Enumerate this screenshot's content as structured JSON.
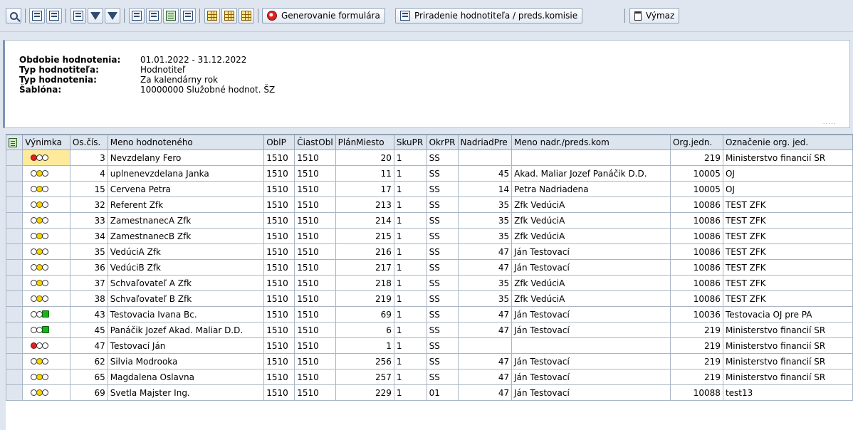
{
  "toolbar": {
    "generate_label": "Generovanie formulára",
    "assign_label": "Priradenie hodnotiteľa / preds.komisie",
    "delete_label": "Výmaz"
  },
  "info": {
    "period_label": "Obdobie hodnotenia:",
    "period_value": "01.01.2022 - 31.12.2022",
    "evaluator_type_label": "Typ hodnotiteľa:",
    "evaluator_type_value": "Hodnotiteľ",
    "evaluation_type_label": "Typ hodnotenia:",
    "evaluation_type_value": "Za kalendárny rok",
    "template_label": "Šablóna:",
    "template_value": "10000000 Služobné hodnot. ŠZ"
  },
  "table": {
    "headers": {
      "exception": "Výnimka",
      "pers_no": "Os.čís.",
      "name": "Meno hodnoteného",
      "oblp": "OblP",
      "partobl": "ČiastObl",
      "planned_pos": "PlánMiesto",
      "skupr": "SkuPR",
      "okrpr": "OkrPR",
      "superior": "NadriadPre",
      "superior_name": "Meno nadr./preds.kom",
      "org_unit": "Org.jedn.",
      "org_unit_name": "Označenie org. jed."
    },
    "rows": [
      {
        "status": "red",
        "hl": true,
        "pers_no": "3",
        "name": "Nevzdelany Fero",
        "oblp": "1510",
        "partobl": "1510",
        "planned_pos": "20",
        "skupr": "1",
        "okrpr": "SS",
        "superior": "",
        "superior_name": "",
        "org_unit": "219",
        "org_unit_name": "Ministerstvo financií SR"
      },
      {
        "status": "yellow",
        "hl": false,
        "pers_no": "4",
        "name": "uplnenevzdelana Janka",
        "oblp": "1510",
        "partobl": "1510",
        "planned_pos": "11",
        "skupr": "1",
        "okrpr": "SS",
        "superior": "45",
        "superior_name": "Akad. Maliar Jozef Panáčik D.D.",
        "org_unit": "10005",
        "org_unit_name": "OJ"
      },
      {
        "status": "yellow",
        "hl": false,
        "pers_no": "15",
        "name": "Cervena Petra",
        "oblp": "1510",
        "partobl": "1510",
        "planned_pos": "17",
        "skupr": "1",
        "okrpr": "SS",
        "superior": "14",
        "superior_name": "Petra Nadriadena",
        "org_unit": "10005",
        "org_unit_name": "OJ"
      },
      {
        "status": "yellow",
        "hl": false,
        "pers_no": "32",
        "name": "Referent Zfk",
        "oblp": "1510",
        "partobl": "1510",
        "planned_pos": "213",
        "skupr": "1",
        "okrpr": "SS",
        "superior": "35",
        "superior_name": "Zfk VedúciA",
        "org_unit": "10086",
        "org_unit_name": "TEST ZFK"
      },
      {
        "status": "yellow",
        "hl": false,
        "pers_no": "33",
        "name": "ZamestnanecA Zfk",
        "oblp": "1510",
        "partobl": "1510",
        "planned_pos": "214",
        "skupr": "1",
        "okrpr": "SS",
        "superior": "35",
        "superior_name": "Zfk VedúciA",
        "org_unit": "10086",
        "org_unit_name": "TEST ZFK"
      },
      {
        "status": "yellow",
        "hl": false,
        "pers_no": "34",
        "name": "ZamestnanecB Zfk",
        "oblp": "1510",
        "partobl": "1510",
        "planned_pos": "215",
        "skupr": "1",
        "okrpr": "SS",
        "superior": "35",
        "superior_name": "Zfk VedúciA",
        "org_unit": "10086",
        "org_unit_name": "TEST ZFK"
      },
      {
        "status": "yellow",
        "hl": false,
        "pers_no": "35",
        "name": "VedúciA Zfk",
        "oblp": "1510",
        "partobl": "1510",
        "planned_pos": "216",
        "skupr": "1",
        "okrpr": "SS",
        "superior": "47",
        "superior_name": "Ján Testovací",
        "org_unit": "10086",
        "org_unit_name": "TEST ZFK"
      },
      {
        "status": "yellow",
        "hl": false,
        "pers_no": "36",
        "name": "VedúciB Zfk",
        "oblp": "1510",
        "partobl": "1510",
        "planned_pos": "217",
        "skupr": "1",
        "okrpr": "SS",
        "superior": "47",
        "superior_name": "Ján Testovací",
        "org_unit": "10086",
        "org_unit_name": "TEST ZFK"
      },
      {
        "status": "yellow",
        "hl": false,
        "pers_no": "37",
        "name": "Schvaľovateľ A Zfk",
        "oblp": "1510",
        "partobl": "1510",
        "planned_pos": "218",
        "skupr": "1",
        "okrpr": "SS",
        "superior": "35",
        "superior_name": "Zfk VedúciA",
        "org_unit": "10086",
        "org_unit_name": "TEST ZFK"
      },
      {
        "status": "yellow",
        "hl": false,
        "pers_no": "38",
        "name": "Schvaľovateľ B Zfk",
        "oblp": "1510",
        "partobl": "1510",
        "planned_pos": "219",
        "skupr": "1",
        "okrpr": "SS",
        "superior": "35",
        "superior_name": "Zfk VedúciA",
        "org_unit": "10086",
        "org_unit_name": "TEST ZFK"
      },
      {
        "status": "green",
        "hl": false,
        "pers_no": "43",
        "name": "Testovacia Ivana Bc.",
        "oblp": "1510",
        "partobl": "1510",
        "planned_pos": "69",
        "skupr": "1",
        "okrpr": "SS",
        "superior": "47",
        "superior_name": "Ján Testovací",
        "org_unit": "10036",
        "org_unit_name": "Testovacia OJ pre PA"
      },
      {
        "status": "green",
        "hl": false,
        "pers_no": "45",
        "name": "Panáčik Jozef Akad. Maliar D.D.",
        "oblp": "1510",
        "partobl": "1510",
        "planned_pos": "6",
        "skupr": "1",
        "okrpr": "SS",
        "superior": "47",
        "superior_name": "Ján Testovací",
        "org_unit": "219",
        "org_unit_name": "Ministerstvo financií SR"
      },
      {
        "status": "red",
        "hl": false,
        "pers_no": "47",
        "name": "Testovací Ján",
        "oblp": "1510",
        "partobl": "1510",
        "planned_pos": "1",
        "skupr": "1",
        "okrpr": "SS",
        "superior": "",
        "superior_name": "",
        "org_unit": "219",
        "org_unit_name": "Ministerstvo financií SR"
      },
      {
        "status": "yellow",
        "hl": false,
        "pers_no": "62",
        "name": "Silvia Modrooka",
        "oblp": "1510",
        "partobl": "1510",
        "planned_pos": "256",
        "skupr": "1",
        "okrpr": "SS",
        "superior": "47",
        "superior_name": "Ján Testovací",
        "org_unit": "219",
        "org_unit_name": "Ministerstvo financií SR"
      },
      {
        "status": "yellow",
        "hl": false,
        "pers_no": "65",
        "name": "Magdalena Oslavna",
        "oblp": "1510",
        "partobl": "1510",
        "planned_pos": "257",
        "skupr": "1",
        "okrpr": "SS",
        "superior": "47",
        "superior_name": "Ján Testovací",
        "org_unit": "219",
        "org_unit_name": "Ministerstvo financií SR"
      },
      {
        "status": "yellow",
        "hl": false,
        "pers_no": "69",
        "name": "Svetla Majster Ing.",
        "oblp": "1510",
        "partobl": "1510",
        "planned_pos": "229",
        "skupr": "1",
        "okrpr": "01",
        "superior": "47",
        "superior_name": "Ján Testovací",
        "org_unit": "10088",
        "org_unit_name": "test13"
      }
    ]
  }
}
